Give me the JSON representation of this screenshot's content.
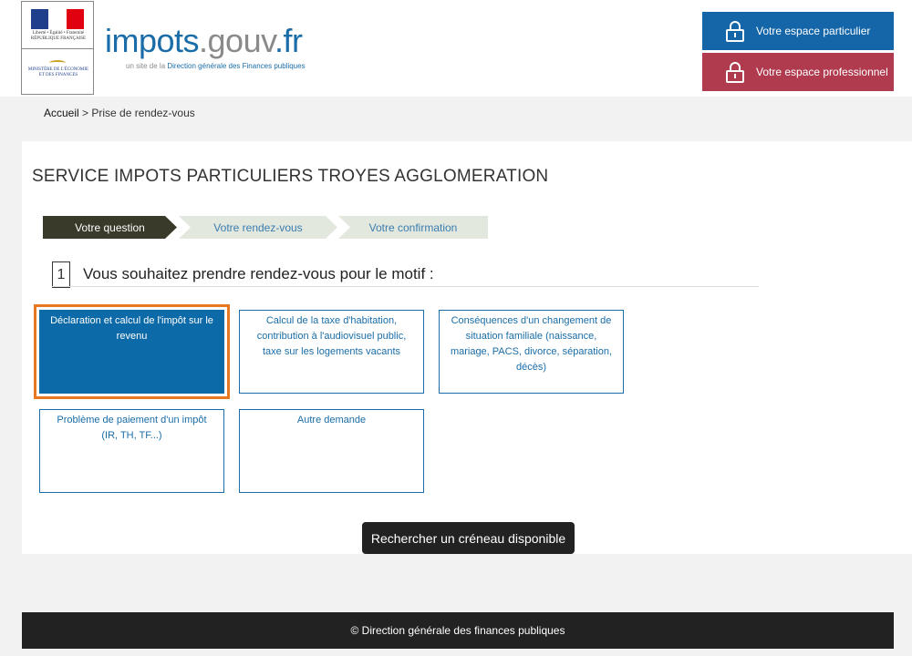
{
  "header": {
    "motto": "Liberté • Égalité • Fraternité",
    "republic": "RÉPUBLIQUE FRANÇAISE",
    "ministry": "MINISTÈRE DE L'ÉCONOMIE ET DES FINANCES",
    "brand": {
      "part1": "impots",
      "part2": ".gouv",
      "part3": ".fr"
    },
    "tagline": {
      "pre": "un site de la ",
      "main": "Direction générale des Finances publiques"
    },
    "espace_particulier": "Votre espace particulier",
    "espace_professionnel": "Votre espace professionnel"
  },
  "breadcrumb": {
    "home": "Accueil",
    "separator": " > ",
    "current": "Prise de rendez-vous"
  },
  "main": {
    "title": "SERVICE IMPOTS PARTICULIERS TROYES AGGLOMERATION",
    "steps": [
      "Votre question",
      "Votre rendez-vous",
      "Votre confirmation"
    ],
    "question_number": "1",
    "question_text": "Vous souhaitez prendre rendez-vous pour le motif :",
    "motifs": [
      "Déclaration et calcul de l'impôt sur le revenu",
      "Calcul de la taxe d'habitation, contribution à l'audiovisuel public, taxe sur les logements vacants",
      "Conséquences d'un changement de situation familiale (naissance, mariage, PACS, divorce, séparation, décès)",
      "Problème de paiement d'un impôt (IR, TH, TF...)",
      "Autre demande"
    ],
    "search_button": "Rechercher un créneau disponible"
  },
  "footer": {
    "text": "© Direction générale des finances publiques"
  },
  "colors": {
    "primary": "#1466a8",
    "pro": "#b03a4e",
    "highlight": "#e87722",
    "dark": "#222222"
  }
}
